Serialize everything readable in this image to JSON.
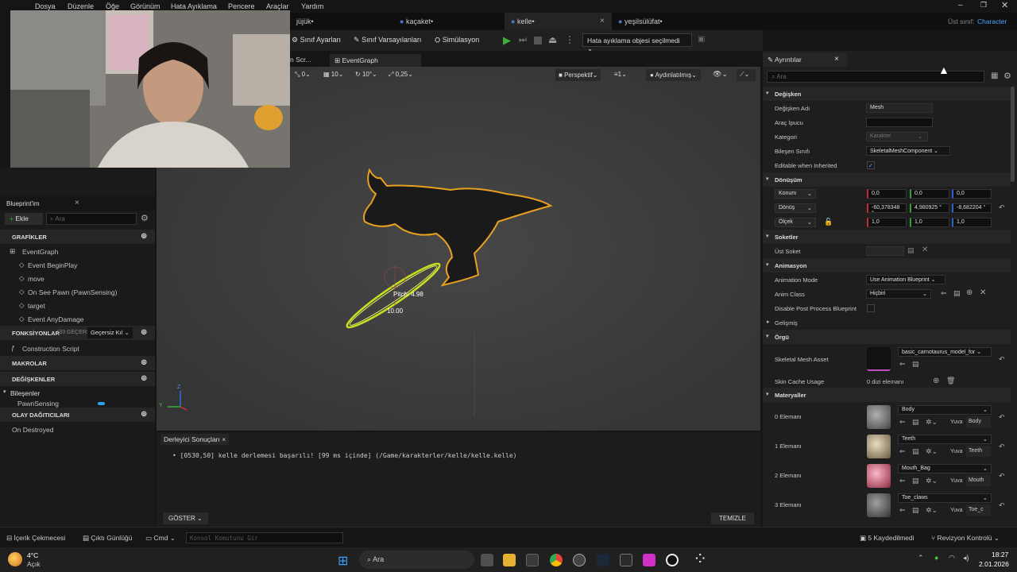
{
  "menu": [
    "Dosya",
    "Düzenle",
    "Öğe",
    "Görünüm",
    "Hata Ayıklama",
    "Pencere",
    "Araçlar",
    "Yardım"
  ],
  "parent_class": {
    "label": "Üst sınıf:",
    "value": "Character"
  },
  "tabs": [
    {
      "label": "jüjük•",
      "active": false
    },
    {
      "label": "kaçaket•",
      "active": false
    },
    {
      "label": "kelle•",
      "active": true
    },
    {
      "label": "yeşilsülüfat•",
      "active": false
    }
  ],
  "toolbar": {
    "class_settings": "Sınıf Ayarları",
    "class_defaults": "Sınıf Varsayılanları",
    "simulation": "Simülasyon",
    "debug_object": "Hata ayıklama objesi seçilmedi"
  },
  "graph_tabs": {
    "scr": "n Scr...",
    "event_graph": "EventGraph"
  },
  "viewport": {
    "grid1": "0",
    "grid2": "10",
    "rot": "10°",
    "scale": "0,25",
    "perspective": "Perspektif",
    "camera_speed": "1",
    "lit": "Aydınlatılmış",
    "pitch_label": "Pitch: 4.98",
    "value_label": "10.00",
    "axis_z": "Z",
    "axis_y": "Y"
  },
  "blueprint_panel": {
    "title": "Blueprint'im",
    "add_label": "Ekle",
    "search_placeholder": "Ara",
    "graphs_header": "GRAFİKLER",
    "event_graph": "EventGraph",
    "events": [
      "Event BeginPlay",
      "move",
      "On See Pawn (PawnSensing)",
      "target",
      "Event AnyDamage"
    ],
    "functions_header": "FONKSİYONLAR",
    "functions_count": "(33 GEÇERS",
    "override_label": "Geçersiz Kıl",
    "construction_script": "Construction Script",
    "macros_header": "MAKROLAR",
    "variables_header": "DEĞİŞKENLER",
    "components_label": "Bileşenler",
    "pawn_sensing": "PawnSensing",
    "dispatchers_header": "OLAY DAĞITICILARI",
    "on_destroyed": "On Destroyed"
  },
  "compiler": {
    "tab": "Derleyici Sonuçları",
    "message": "[0530,50] kelle derlemesi başarılı! [99 ms içinde] (/Game/karakterler/kelle/kelle.kelle)",
    "show_button": "GÖSTER",
    "clear_button": "TEMİZLE"
  },
  "details": {
    "title": "Ayrıntılar",
    "search_placeholder": "Ara",
    "variable_section": "Değişken",
    "var_name_label": "Değişken Adı",
    "var_name_value": "Mesh",
    "tooltip_label": "Araç İpucu",
    "tooltip_value": "",
    "category_label": "Kategori",
    "category_value": "Karakter",
    "component_class_label": "Bileşen Sınıfı",
    "component_class_value": "SkeletalMeshComponent",
    "editable_label": "Editable when Inherited",
    "editable_checked": true,
    "transform_section": "Dönüşüm",
    "location_label": "Konum",
    "location_values": [
      "0,0",
      "0,0",
      "0,0"
    ],
    "rotation_label": "Dönüş",
    "rotation_values": [
      "-60,378348 °",
      "4,980925 °",
      "-8,682204 °"
    ],
    "scale_label": "Ölçek",
    "scale_values": [
      "1,0",
      "1,0",
      "1,0"
    ],
    "sockets_section": "Soketler",
    "parent_socket_label": "Üst Soket",
    "animation_section": "Animasyon",
    "anim_mode_label": "Animation Mode",
    "anim_mode_value": "Use Animation Blueprint",
    "anim_class_label": "Anim Class",
    "anim_class_value": "Hiçbiri",
    "disable_pp_label": "Disable Post Process Blueprint",
    "advanced_label": "Gelişmiş",
    "mesh_section": "Örgü",
    "skeletal_mesh_label": "Skeletal Mesh Asset",
    "skeletal_mesh_value": "basic_carnotaurus_model_for",
    "skin_cache_label": "Skin Cache Usage",
    "skin_cache_value": "0 dizi elemanı",
    "materials_section": "Materyaller",
    "materials": [
      {
        "label": "0 Elemanı",
        "name": "Body",
        "slot_label": "Yuva",
        "slot": "Body",
        "color": "#8a8a8a"
      },
      {
        "label": "1 Elemanı",
        "name": "Teeth",
        "slot_label": "Yuva",
        "slot": "Teeth",
        "color": "#c9b89a"
      },
      {
        "label": "2 Elemanı",
        "name": "Mouth_Bag",
        "slot_label": "Yuva",
        "slot": "Mouth",
        "color": "#e07a8a"
      },
      {
        "label": "3 Elemanı",
        "name": "Toe_claws",
        "slot_label": "Yuva",
        "slot": "Toe_c",
        "color": "#707070"
      }
    ]
  },
  "statusbar": {
    "content_drawer": "İçerik Çekmecesi",
    "output_log": "Çıktı Günlüğü",
    "cmd": "Cmd",
    "console_placeholder": "Konsol Komutunu Gir",
    "saved": "5 Kaydedilmedi",
    "revision": "Revizyon Kontrolü"
  },
  "taskbar": {
    "weather_temp": "4°C",
    "weather_desc": "Açık",
    "search": "Ara",
    "time": "18:27",
    "date": "2.01.2026"
  }
}
